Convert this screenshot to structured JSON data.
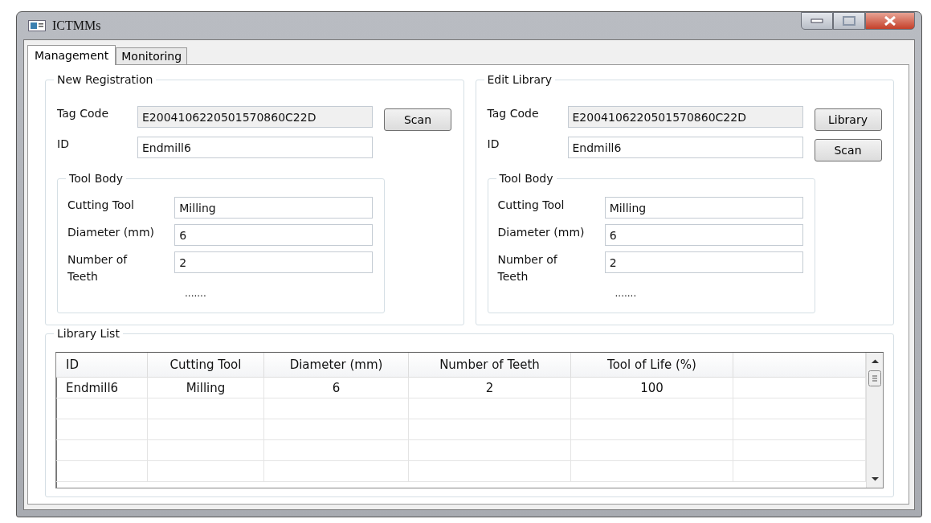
{
  "window": {
    "title": "ICTMMs"
  },
  "tabs": [
    {
      "label": "Management",
      "selected": true
    },
    {
      "label": "Monitoring",
      "selected": false
    }
  ],
  "panels": [
    {
      "title": "New Registration",
      "fields": [
        {
          "label": "Tag Code",
          "value": "E2004106220501570860C22D",
          "read_only": true,
          "button": "Scan"
        },
        {
          "label": "ID",
          "value": "Endmill6",
          "read_only": false
        }
      ],
      "tool_body": {
        "title": "Tool Body",
        "fields": [
          {
            "label": "Cutting Tool",
            "value": "Milling"
          },
          {
            "label": "Diameter (mm)",
            "value": "6"
          },
          {
            "label": "Number of Teeth",
            "value": "2"
          }
        ],
        "more": "......."
      }
    },
    {
      "title": "Edit Library",
      "fields": [
        {
          "label": "Tag Code",
          "value": "E2004106220501570860C22D",
          "read_only": true,
          "button": "Library"
        },
        {
          "label": "ID",
          "value": "Endmill6",
          "read_only": false,
          "button": "Scan"
        }
      ],
      "tool_body": {
        "title": "Tool Body",
        "fields": [
          {
            "label": "Cutting Tool",
            "value": "Milling"
          },
          {
            "label": "Diameter (mm)",
            "value": "6"
          },
          {
            "label": "Number of Teeth",
            "value": "2"
          }
        ],
        "more": "......."
      }
    }
  ],
  "library_list": {
    "title": "Library List",
    "columns": [
      "ID",
      "Cutting Tool",
      "Diameter (mm)",
      "Number of Teeth",
      "Tool of Life (%)"
    ],
    "rows": [
      [
        "Endmill6",
        "Milling",
        "6",
        "2",
        "100"
      ]
    ]
  }
}
